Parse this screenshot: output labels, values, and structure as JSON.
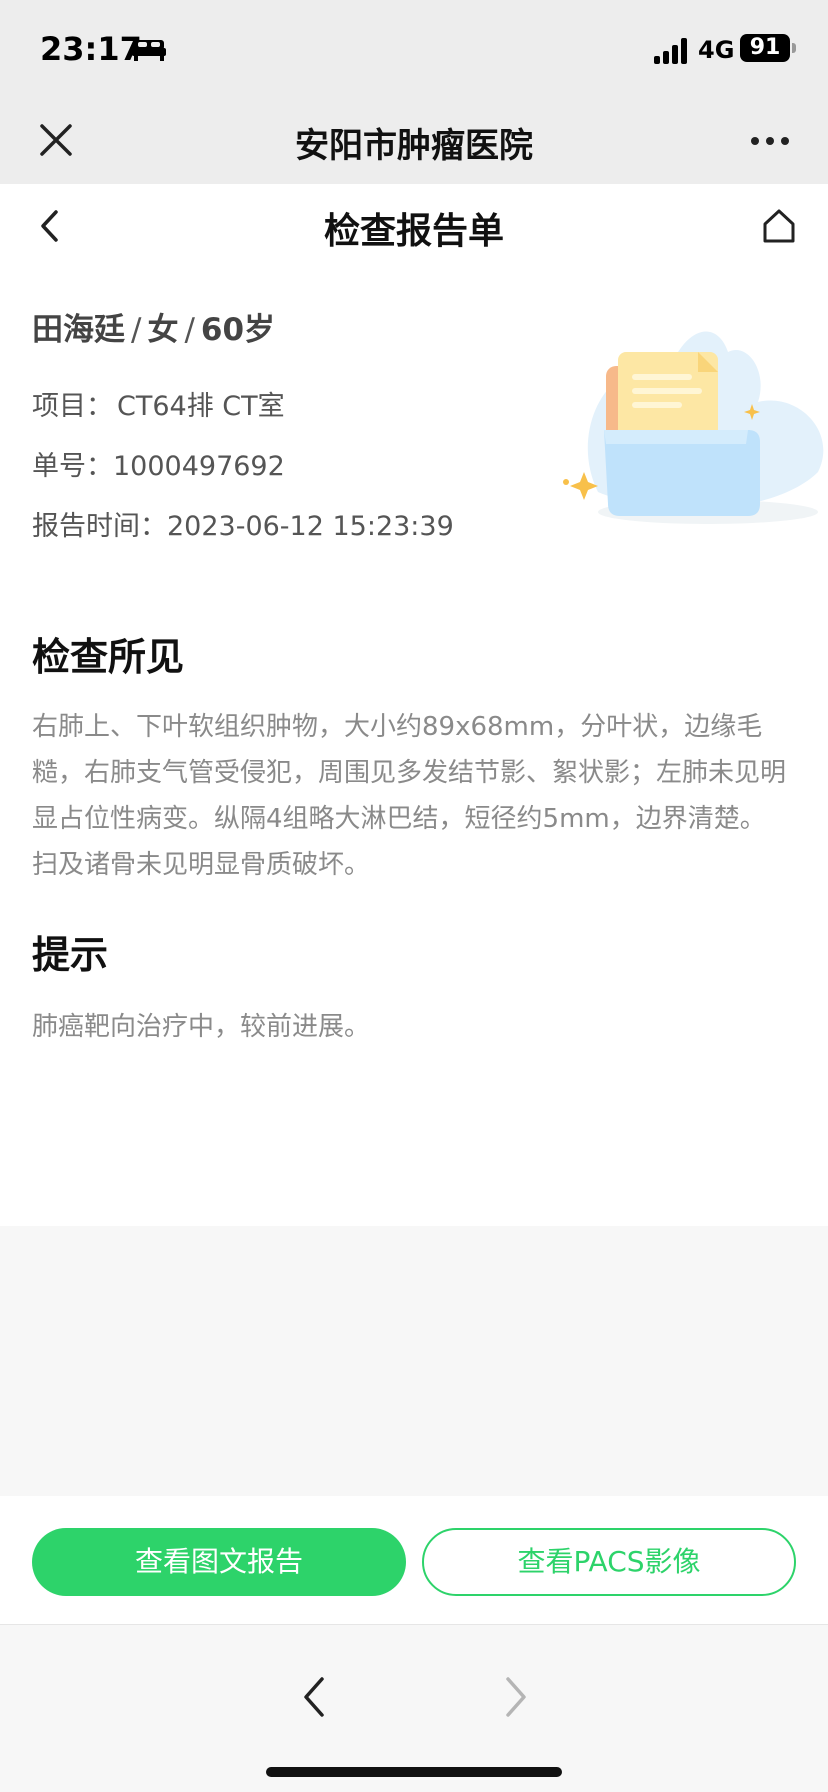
{
  "status_bar": {
    "time": "23:17",
    "network": "4G",
    "battery": "91"
  },
  "nav": {
    "title": "安阳市肿瘤医院"
  },
  "page": {
    "title": "检查报告单"
  },
  "patient": {
    "name": "田海廷",
    "gender": "女",
    "age": "60岁",
    "separator": "/"
  },
  "info": {
    "item_label": "项目：",
    "item_value": "CT64排 CT室",
    "number_label": "单号：",
    "number_value": "1000497692",
    "time_label": "报告时间：",
    "time_value": "2023-06-12 15:23:39"
  },
  "findings": {
    "title": "检查所见",
    "text": "右肺上、下叶软组织肿物，大小约89x68mm，分叶状，边缘毛糙，右肺支气管受侵犯，周围见多发结节影、絮状影；左肺未见明显占位性病变。纵隔4组略大淋巴结，短径约5mm，边界清楚。 扫及诸骨未见明显骨质破坏。"
  },
  "hint": {
    "title": "提示",
    "text": "肺癌靶向治疗中，较前进展。"
  },
  "buttons": {
    "report": "查看图文报告",
    "pacs": "查看PACS影像"
  },
  "icons": {
    "bed": "bed-icon",
    "signal": "signal-icon",
    "close": "close-icon",
    "more": "more-icon",
    "back": "chevron-left-icon",
    "home": "home-icon",
    "forward": "chevron-right-icon"
  },
  "colors": {
    "accent": "#2dd36a",
    "nav_bg": "#ededed",
    "body_text": "#8a8a8a"
  }
}
